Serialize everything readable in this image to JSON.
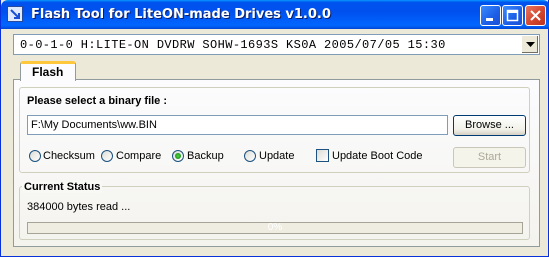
{
  "window": {
    "title": "Flash Tool for LiteON-made Drives v1.0.0"
  },
  "device": {
    "selected": "0-0-1-0 H:LITE-ON DVDRW SOHW-1693S KS0A 2005/07/05 15:30"
  },
  "tabs": [
    {
      "label": "Flash"
    }
  ],
  "file_section": {
    "label": "Please select a binary file :",
    "path_value": "F:\\My Documents\\ww.BIN",
    "browse_label": "Browse ..."
  },
  "modes": [
    {
      "label": "Checksum",
      "checked": false
    },
    {
      "label": "Compare",
      "checked": false
    },
    {
      "label": "Backup",
      "checked": true
    },
    {
      "label": "Update",
      "checked": false
    }
  ],
  "update_boot_code": {
    "label": "Update Boot Code",
    "checked": false
  },
  "start_label": "Start",
  "status": {
    "label": "Current Status",
    "message": "384000 bytes read ...",
    "progress_percent": 0,
    "progress_text": "0%"
  }
}
